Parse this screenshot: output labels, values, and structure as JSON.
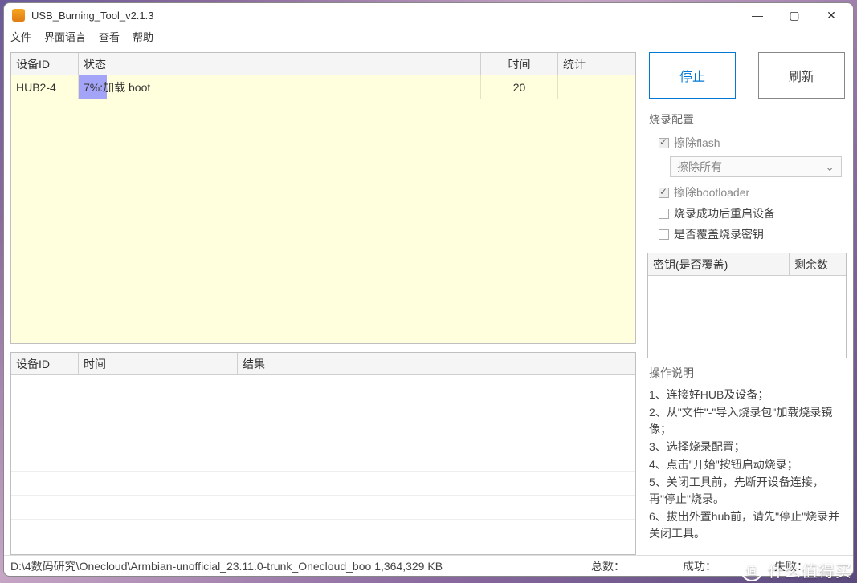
{
  "window": {
    "title": "USB_Burning_Tool_v2.1.3"
  },
  "menu": {
    "file": "文件",
    "language": "界面语言",
    "view": "查看",
    "help": "帮助"
  },
  "topGrid": {
    "headers": {
      "id": "设备ID",
      "status": "状态",
      "time": "时间",
      "stat": "统计"
    },
    "rows": [
      {
        "id": "HUB2-4",
        "percent": "7%",
        "status": "加载 boot",
        "progress_pct": 7,
        "time": "20",
        "stat": ""
      }
    ]
  },
  "bottomGrid": {
    "headers": {
      "id": "设备ID",
      "time": "时间",
      "result": "结果"
    }
  },
  "buttons": {
    "stop": "停止",
    "refresh": "刷新"
  },
  "config": {
    "title": "烧录配置",
    "erase_flash": "擦除flash",
    "erase_mode": "擦除所有",
    "erase_bootloader": "擦除bootloader",
    "reboot_after": "烧录成功后重启设备",
    "overwrite_key": "是否覆盖烧录密钥"
  },
  "keyGrid": {
    "headers": {
      "key": "密钥(是否覆盖)",
      "remain": "剩余数"
    }
  },
  "instructions": {
    "title": "操作说明",
    "items": [
      "1、连接好HUB及设备；",
      "2、从\"文件\"-\"导入烧录包\"加载烧录镜像；",
      "3、选择烧录配置；",
      "4、点击\"开始\"按钮启动烧录；",
      "5、关闭工具前，先断开设备连接，再\"停止\"烧录。",
      "6、拔出外置hub前，请先\"停止\"烧录并关闭工具。"
    ]
  },
  "statusbar": {
    "path": "D:\\4数码研究\\Onecloud\\Armbian-unofficial_23.11.0-trunk_Onecloud_boo",
    "size": "1,364,329 KB",
    "total_label": "总数：",
    "success_label": "成功：",
    "fail_label": "失败："
  },
  "brand": {
    "text": "什么值得买",
    "logo": "值"
  }
}
